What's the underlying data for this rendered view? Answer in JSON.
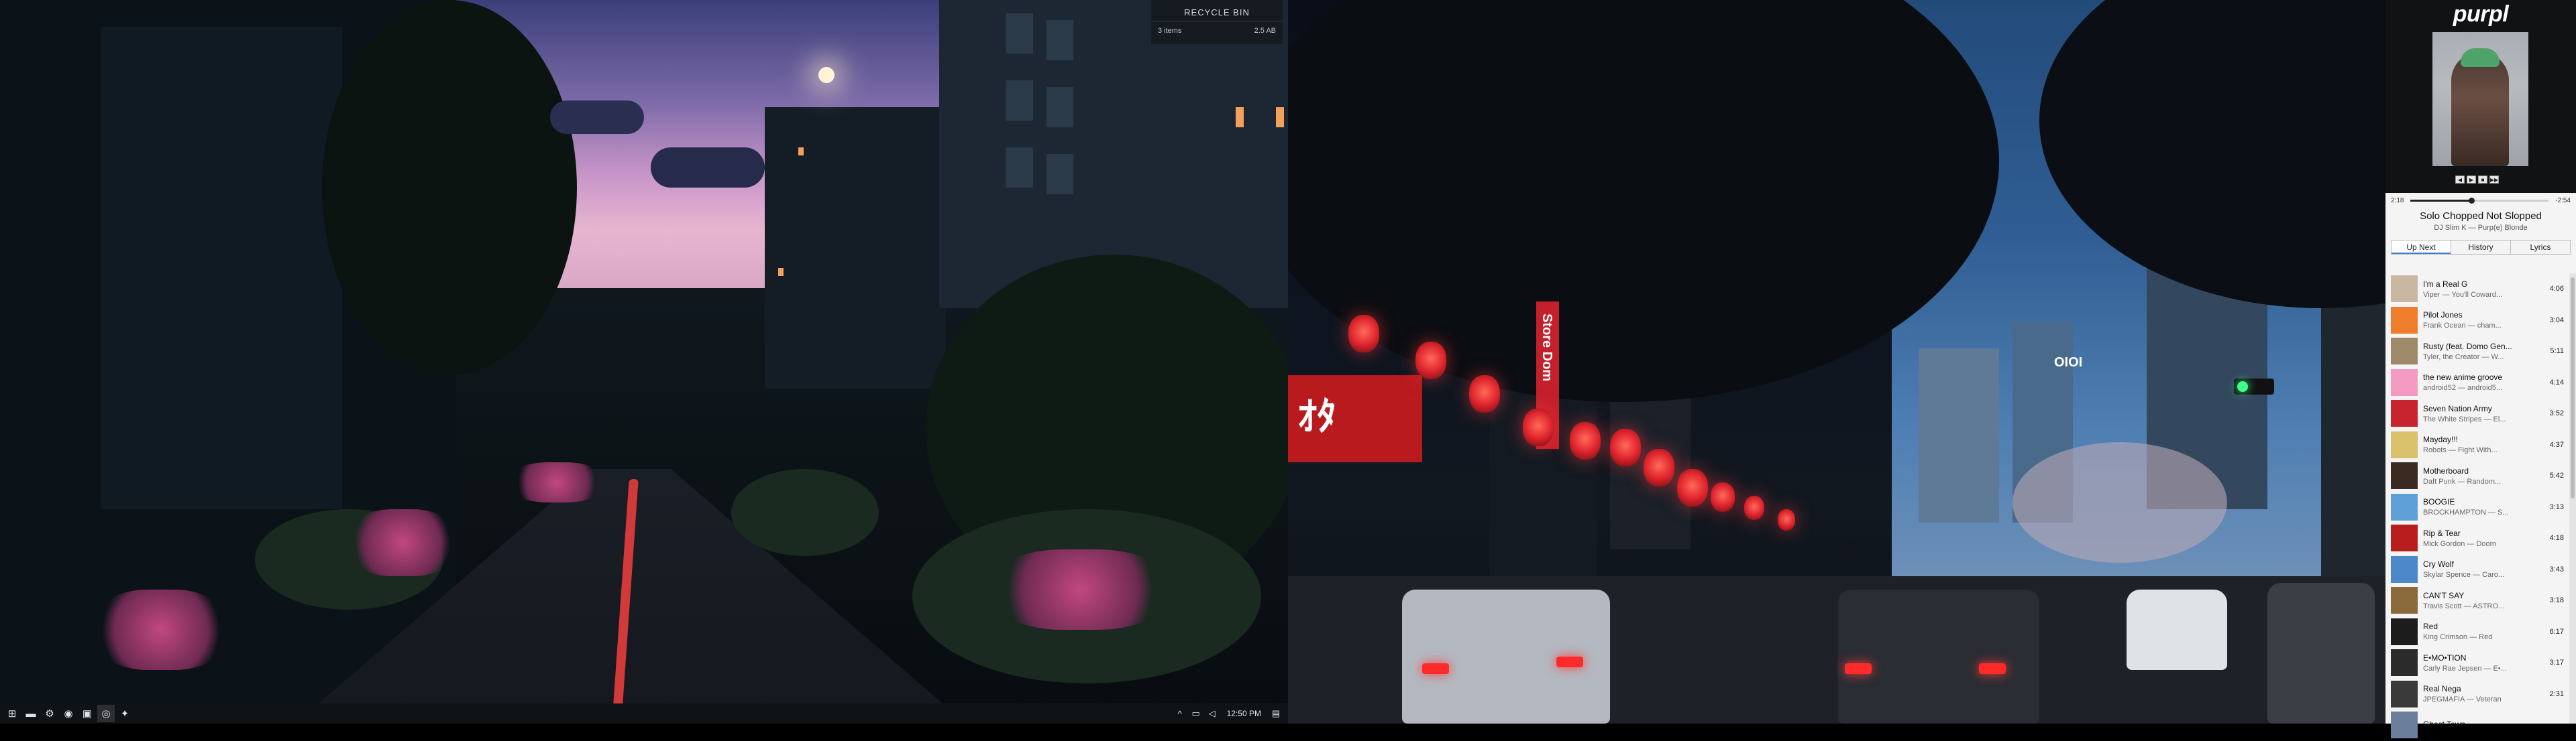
{
  "recycle_bin": {
    "title": "RECYCLE BIN",
    "items": "3 items",
    "size": "2.5 AB"
  },
  "taskbar": {
    "icons": [
      {
        "name": "start-icon",
        "glyph": "⊞"
      },
      {
        "name": "file-explorer-icon",
        "glyph": "▬"
      },
      {
        "name": "steam-icon",
        "glyph": "⚙"
      },
      {
        "name": "chrome-icon",
        "glyph": "◉"
      },
      {
        "name": "app-icon",
        "glyph": "▣"
      },
      {
        "name": "media-player-icon",
        "glyph": "◎"
      },
      {
        "name": "steam-tray-icon",
        "glyph": "✦"
      }
    ],
    "clock": "12:50 PM",
    "tray_chevron": "^",
    "notification_glyph": "▤"
  },
  "music": {
    "brand": "purpl",
    "elapsed": "2:18",
    "remaining": "-2:54",
    "progress": 0.44,
    "now_title": "Solo Chopped Not Slopped",
    "now_sub": "DJ Slim K — Purp(e) Blonde",
    "album_controls": [
      "◀",
      "▶",
      "■",
      "▶▶"
    ],
    "tabs": [
      "Up Next",
      "History",
      "Lyrics"
    ],
    "active_tab": 0,
    "tracks": [
      {
        "title": "I'm a Real G",
        "sub": "Viper — You'll Coward...",
        "dur": "4:06",
        "color": "#c9b7a2"
      },
      {
        "title": "Pilot Jones",
        "sub": "Frank Ocean — cham...",
        "dur": "3:04",
        "color": "#f07d2c"
      },
      {
        "title": "Rusty (feat. Domo Gen...",
        "sub": "Tyler, the Creator — W...",
        "dur": "5:11",
        "color": "#9e8a6a"
      },
      {
        "title": "the new anime groove",
        "sub": "android52 — android5...",
        "dur": "4:14",
        "color": "#f39ac3"
      },
      {
        "title": "Seven Nation Army",
        "sub": "The White Stripes — El...",
        "dur": "3:52",
        "color": "#c8242e"
      },
      {
        "title": "Mayday!!!",
        "sub": "Robots — Fight With...",
        "dur": "4:37",
        "color": "#d9c06a"
      },
      {
        "title": "Motherboard",
        "sub": "Daft Punk — Random...",
        "dur": "5:42",
        "color": "#3a2a22"
      },
      {
        "title": "BOOGIE",
        "sub": "BROCKHAMPTON — S...",
        "dur": "3:13",
        "color": "#5fa0d8"
      },
      {
        "title": "Rip & Tear",
        "sub": "Mick Gordon — Doom",
        "dur": "4:18",
        "color": "#b81e1e"
      },
      {
        "title": "Cry Wolf",
        "sub": "Skylar Spence — Caro...",
        "dur": "3:43",
        "color": "#4c87c7"
      },
      {
        "title": "CAN'T SAY",
        "sub": "Travis Scott — ASTRO...",
        "dur": "3:18",
        "color": "#8a6a3a"
      },
      {
        "title": "Red",
        "sub": "King Crimson — Red",
        "dur": "6:17",
        "color": "#1c1c1c"
      },
      {
        "title": "E•MO•TION",
        "sub": "Carly Rae Jepsen — E•...",
        "dur": "3:17",
        "color": "#2b2b2b"
      },
      {
        "title": "Real Nega",
        "sub": "JPEGMAFIA — Veteran",
        "dur": "2:31",
        "color": "#3a3a3a"
      },
      {
        "title": "Ghost Town",
        "sub": "",
        "dur": "",
        "color": "#6b7f9a"
      }
    ]
  },
  "signs": {
    "oioi": "OIOI",
    "store_vertical": "Store Dom",
    "kanji_board": "ｵﾀ"
  },
  "colors": {
    "accent": "#3a7bd5",
    "panel_bg": "#f4f4f4",
    "taskbar_bg": "#0f1216"
  }
}
